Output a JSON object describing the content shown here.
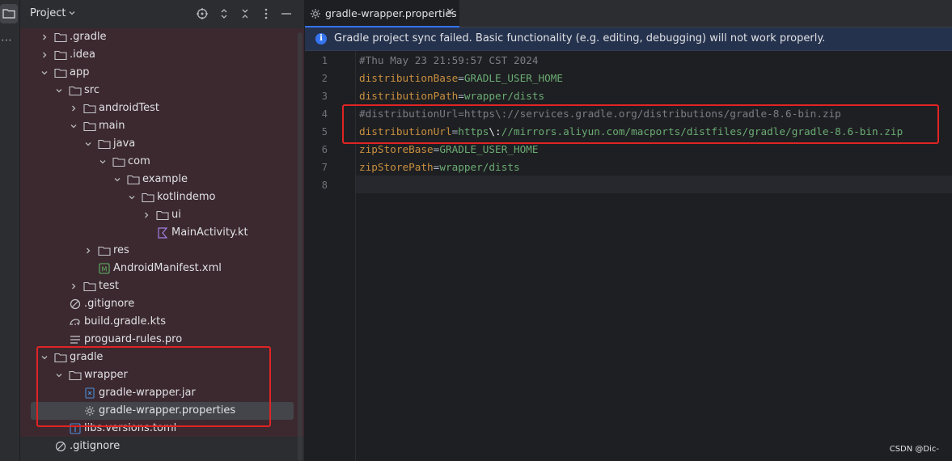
{
  "project_panel": {
    "title": "Project",
    "tree": [
      {
        "label": ".gradle",
        "icon": "folder-icon"
      },
      {
        "label": ".idea",
        "icon": "folder-icon"
      },
      {
        "label": "app",
        "icon": "folder-icon"
      },
      {
        "label": "src",
        "icon": "folder-icon"
      },
      {
        "label": "androidTest",
        "icon": "folder-icon"
      },
      {
        "label": "main",
        "icon": "folder-icon"
      },
      {
        "label": "java",
        "icon": "folder-icon"
      },
      {
        "label": "com",
        "icon": "folder-icon"
      },
      {
        "label": "example",
        "icon": "folder-icon"
      },
      {
        "label": "kotlindemo",
        "icon": "folder-icon"
      },
      {
        "label": "ui",
        "icon": "folder-icon"
      },
      {
        "label": "MainActivity.kt",
        "icon": "kotlin-file-icon"
      },
      {
        "label": "res",
        "icon": "folder-icon"
      },
      {
        "label": "AndroidManifest.xml",
        "icon": "manifest-icon"
      },
      {
        "label": "test",
        "icon": "folder-icon"
      },
      {
        "label": ".gitignore",
        "icon": "ignore-file-icon"
      },
      {
        "label": "build.gradle.kts",
        "icon": "gradle-file-icon"
      },
      {
        "label": "proguard-rules.pro",
        "icon": "text-file-icon"
      },
      {
        "label": "gradle",
        "icon": "folder-icon"
      },
      {
        "label": "wrapper",
        "icon": "folder-icon"
      },
      {
        "label": "gradle-wrapper.jar",
        "icon": "jar-file-icon"
      },
      {
        "label": "gradle-wrapper.properties",
        "icon": "properties-file-icon"
      },
      {
        "label": "libs.versions.toml",
        "icon": "toml-file-icon"
      },
      {
        "label": ".gitignore",
        "icon": "ignore-file-icon"
      }
    ]
  },
  "editor": {
    "tab_label": "gradle-wrapper.properties",
    "banner": "Gradle project sync failed. Basic functionality (e.g. editing, debugging) will not work properly.",
    "line_numbers": [
      "1",
      "2",
      "3",
      "4",
      "5",
      "6",
      "7",
      "8"
    ],
    "lines": {
      "l1": "#Thu May 23 21:59:57 CST 2024",
      "l2_key": "distributionBase",
      "l2_val": "GRADLE_USER_HOME",
      "l3_key": "distributionPath",
      "l3_val": "wrapper/dists",
      "l4": "#distributionUrl=https\\://services.gradle.org/distributions/gradle-8.6-bin.zip",
      "l5_key": "distributionUrl",
      "l5_val_a": "https",
      "l5_esc": "\\:",
      "l5_val_b": "//mirrors.aliyun.com/macports/distfiles/gradle/gradle-8.6-bin.zip",
      "l6_key": "zipStoreBase",
      "l6_val": "GRADLE_USER_HOME",
      "l7_key": "zipStorePath",
      "l7_val": "wrapper/dists",
      "eq": "="
    }
  },
  "watermark": "CSDN @Dic-",
  "colors": {
    "highlight_box": "#e02424",
    "accent": "#3574f0"
  }
}
